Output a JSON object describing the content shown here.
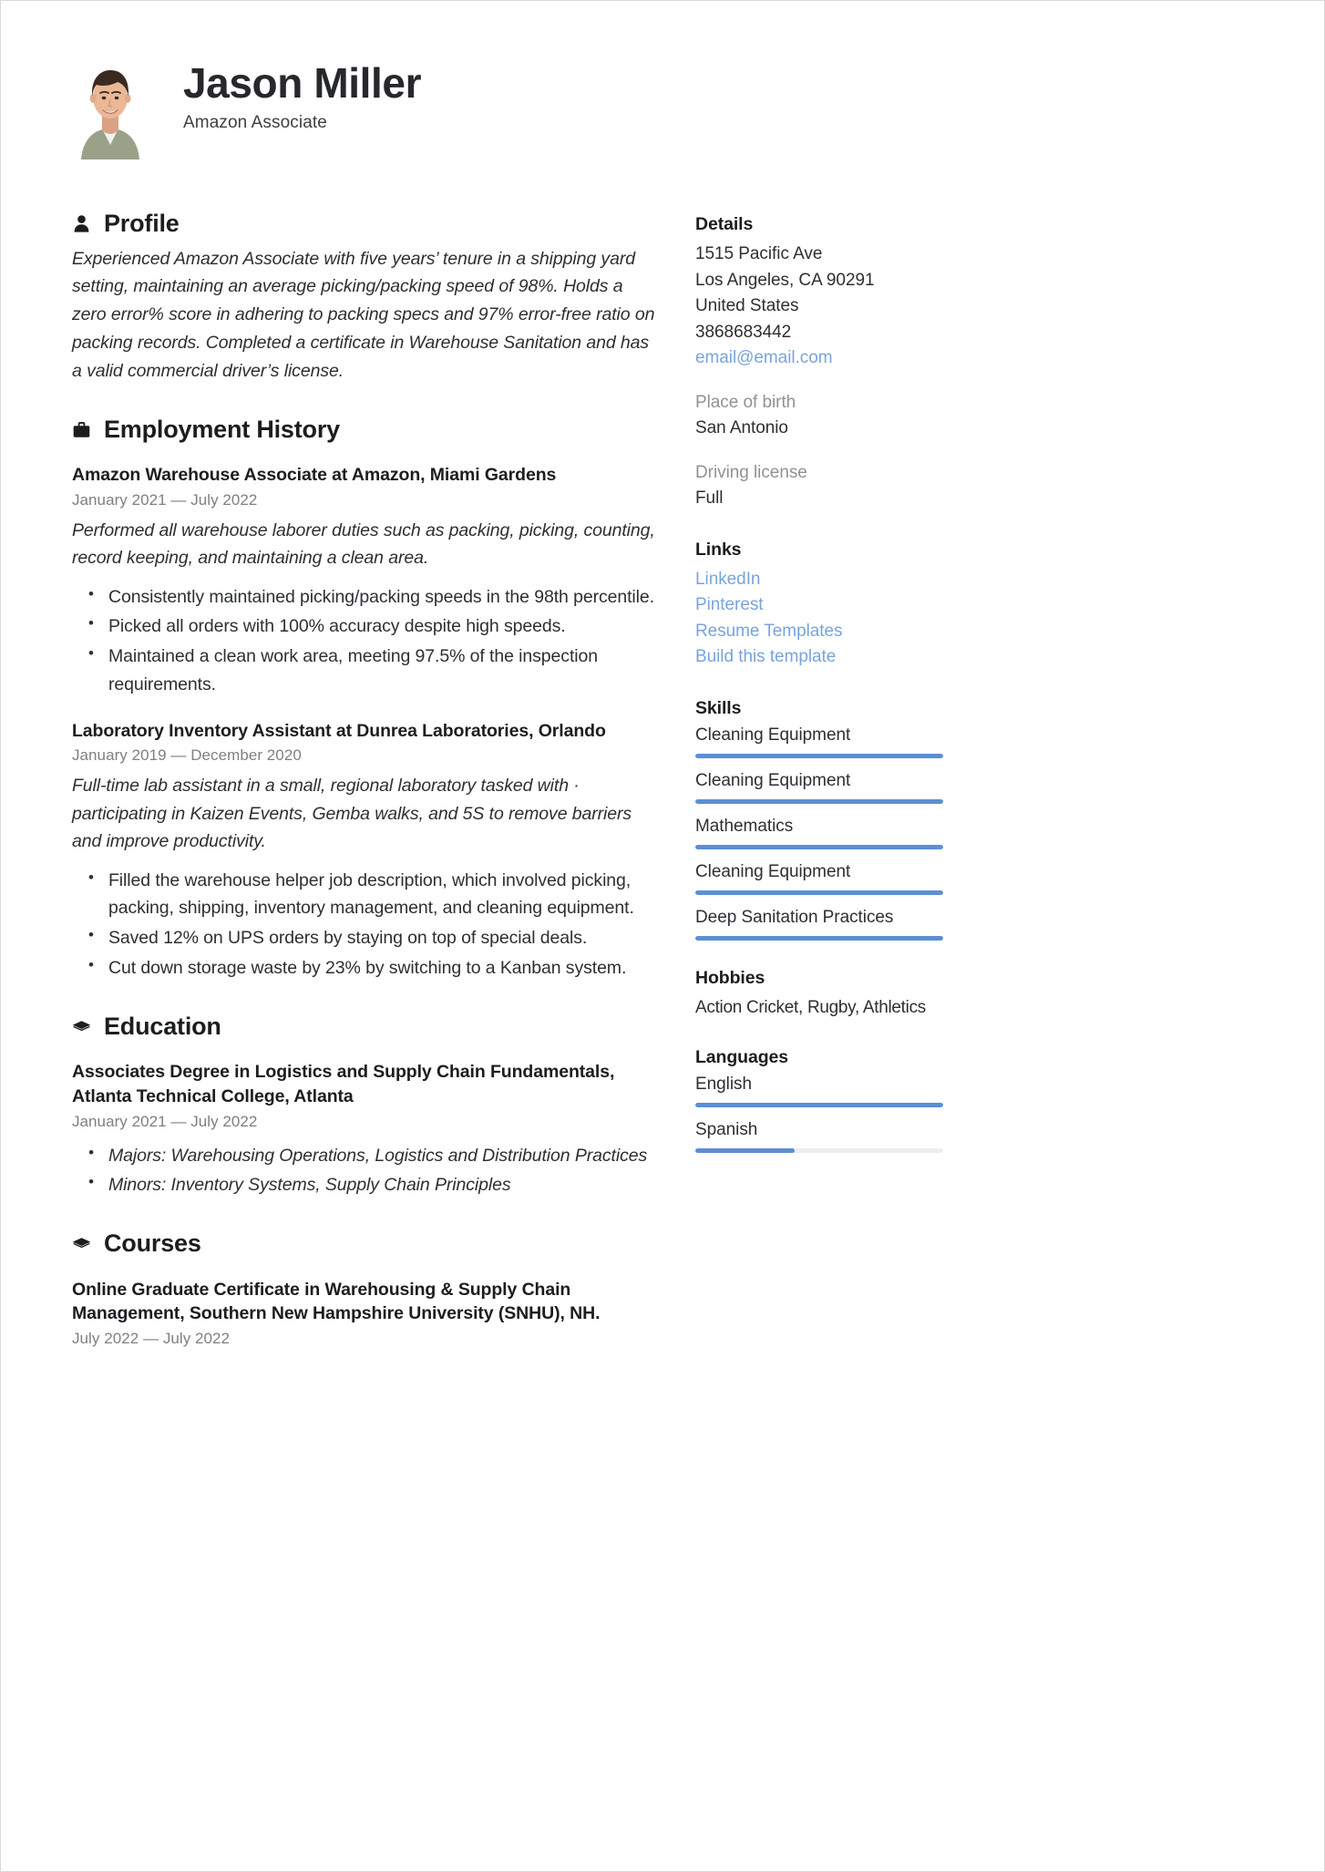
{
  "theme": {
    "accent": "#5b8fd4",
    "link": "#79a4dc",
    "heading": "#1b1d20",
    "body": "#2d2f33",
    "muted": "#7d8085",
    "track": "#eceef0"
  },
  "header": {
    "name": "Jason Miller",
    "title": "Amazon Associate"
  },
  "profile": {
    "heading": "Profile",
    "text": "Experienced Amazon Associate with five years’ tenure in a shipping yard setting, maintaining an average picking/packing speed of 98%. Holds a zero error% score in adhering to packing specs and 97% error-free ratio on packing records. Completed a certificate in Warehouse Sanitation and has a valid commercial driver’s license."
  },
  "employment": {
    "heading": "Employment History",
    "entries": [
      {
        "title": "Amazon Warehouse Associate at Amazon, Miami Gardens",
        "date": "January 2021 — July 2022",
        "description": "Performed all warehouse laborer duties such as packing, picking, counting, record keeping, and maintaining a clean area.",
        "bullets": [
          "Consistently maintained picking/packing speeds in the 98th percentile.",
          "Picked all orders with 100% accuracy despite high speeds.",
          "Maintained a clean work area, meeting 97.5% of the inspection requirements."
        ]
      },
      {
        "title": "Laboratory Inventory Assistant  at  Dunrea Laboratories, Orlando",
        "date": "January 2019 — December 2020",
        "description": "Full-time lab assistant in a small, regional laboratory tasked with · participating in Kaizen Events, Gemba walks, and 5S to remove barriers and improve productivity.",
        "bullets": [
          "Filled the warehouse helper job description, which involved picking, packing, shipping, inventory management, and cleaning equipment.",
          "Saved 12% on UPS orders by staying on top of special deals.",
          "Cut down storage waste by 23% by switching to a Kanban system."
        ]
      }
    ]
  },
  "education": {
    "heading": "Education",
    "entries": [
      {
        "title": "Associates Degree in Logistics and Supply Chain Fundamentals, Atlanta Technical College, Atlanta",
        "date": "January 2021 — July 2022",
        "bullets": [
          "Majors: Warehousing Operations, Logistics and Distribution Practices",
          "Minors: Inventory Systems, Supply Chain Principles"
        ]
      }
    ]
  },
  "courses": {
    "heading": "Courses",
    "entries": [
      {
        "title": "Online Graduate Certificate in Warehousing & Supply Chain Management, Southern New Hampshire University (SNHU), NH.",
        "date": "July 2022 — July 2022"
      }
    ]
  },
  "sidebar": {
    "details": {
      "heading": "Details",
      "address_line1": "1515 Pacific Ave",
      "address_line2": "Los Angeles, CA 90291",
      "country": "United States",
      "phone": "3868683442",
      "email": "email@email.com",
      "place_of_birth_label": "Place of birth",
      "place_of_birth_value": "San Antonio",
      "driving_license_label": "Driving license",
      "driving_license_value": "Full"
    },
    "links": {
      "heading": "Links",
      "items": [
        {
          "label": "LinkedIn"
        },
        {
          "label": "Pinterest"
        },
        {
          "label": "Resume Templates"
        },
        {
          "label": "Build this template"
        }
      ]
    },
    "skills": {
      "heading": "Skills",
      "items": [
        {
          "label": "Cleaning Equipment",
          "level": 100
        },
        {
          "label": "Cleaning Equipment",
          "level": 100
        },
        {
          "label": "Mathematics",
          "level": 100
        },
        {
          "label": "Cleaning Equipment",
          "level": 100
        },
        {
          "label": "Deep Sanitation Practices",
          "level": 100
        }
      ]
    },
    "hobbies": {
      "heading": "Hobbies",
      "text": "Action Cricket, Rugby, Athletics"
    },
    "languages": {
      "heading": "Languages",
      "items": [
        {
          "label": "English",
          "level": 100
        },
        {
          "label": "Spanish",
          "level": 40
        }
      ]
    }
  }
}
